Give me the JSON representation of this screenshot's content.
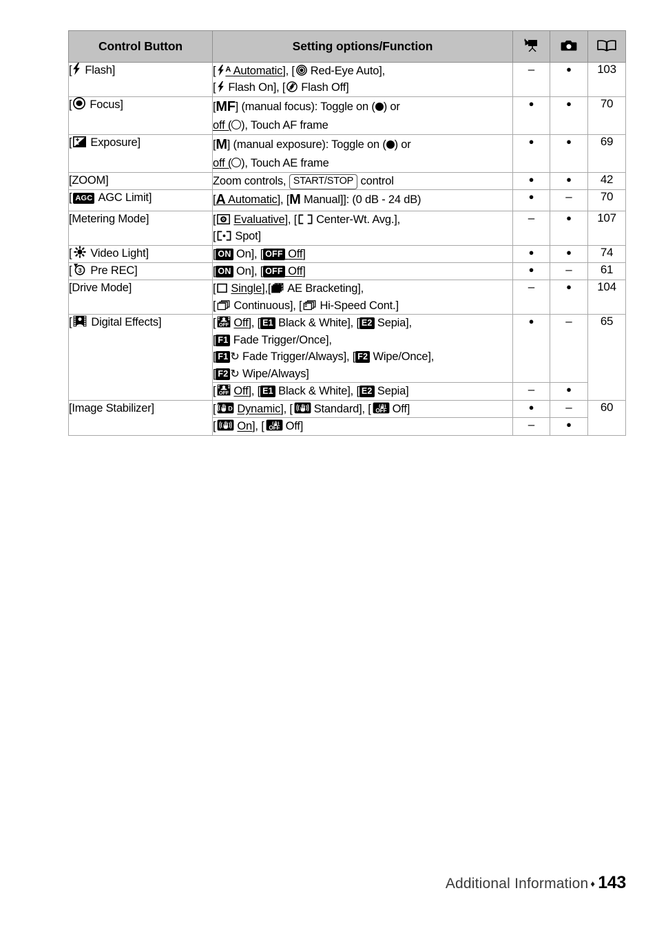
{
  "document": {
    "footer_label": "Additional Information",
    "footer_separator": "♦",
    "page_number": "143"
  },
  "table": {
    "headers": {
      "control_button": "Control Button",
      "setting_options": "Setting options/Function",
      "movie_mode_icon": "video-camera-icon",
      "photo_mode_icon": "photo-camera-icon",
      "page_ref_icon": "open-book-icon"
    },
    "marks": {
      "available": "●",
      "unavailable": "–"
    },
    "rows": [
      {
        "button_label": "Flash]",
        "button_bracket": "[",
        "button_icon": "flash-icon",
        "options_lines": [
          "[ A Automatic], [ Red-Eye Auto],",
          "[ Flash On], [ Flash Off]"
        ],
        "options_text": "[⚡A Automatic], [◉ Red-Eye Auto], [⚡ Flash On], [⚡⃠ Flash Off]",
        "default_option": "Automatic",
        "movie": "–",
        "photo": "●",
        "page": "103"
      },
      {
        "button_label": "Focus]",
        "button_bracket": "[",
        "button_icon": "focus-icon",
        "options_text": "[MF] (manual focus): Toggle on (●) or off (○), Touch AF frame",
        "default_option": "off",
        "movie": "●",
        "photo": "●",
        "page": "70"
      },
      {
        "button_label": "Exposure]",
        "button_bracket": "[",
        "button_icon": "exposure-icon",
        "options_text": "[M] (manual exposure): Toggle on (●) or off (○), Touch AE frame",
        "default_option": "off",
        "movie": "●",
        "photo": "●",
        "page": "69"
      },
      {
        "button_label": "[ZOOM]",
        "button_icon": "",
        "options_text": "Zoom controls, START/STOP control",
        "keycap": "START/STOP",
        "movie": "●",
        "photo": "●",
        "page": "42"
      },
      {
        "button_label": "AGC Limit]",
        "button_bracket": "[",
        "button_icon": "agc-badge-icon",
        "button_badge": "AGC",
        "options_text": "[A Automatic], [M Manual]]: (0 dB - 24 dB)",
        "default_option": "Automatic",
        "movie": "●",
        "photo": "–",
        "page": "70"
      },
      {
        "button_label": "[Metering Mode]",
        "button_icon": "",
        "options_text": "[Evaluative], [Center-Wt. Avg.], [Spot]",
        "default_option": "Evaluative",
        "movie": "–",
        "photo": "●",
        "page": "107"
      },
      {
        "button_label": "Video Light]",
        "button_bracket": "[",
        "button_icon": "video-light-icon",
        "options_text": "[ON On], [OFF Off]",
        "default_option": "Off",
        "movie": "●",
        "photo": "●",
        "page": "74"
      },
      {
        "button_label": "Pre REC]",
        "button_bracket": "[",
        "button_icon": "pre-rec-icon",
        "options_text": "[ON On], [OFF Off]",
        "default_option": "Off",
        "movie": "●",
        "photo": "–",
        "page": "61"
      },
      {
        "button_label": "[Drive Mode]",
        "button_icon": "",
        "options_text": "[Single], [AE Bracketing], [Continuous], [Hi-Speed Cont.]",
        "default_option": "Single",
        "movie": "–",
        "photo": "●",
        "page": "104"
      },
      {
        "button_label": "Digital Effects]",
        "button_bracket": "[",
        "button_icon": "digital-effects-icon",
        "options_text": "[OFF Off], [E1 Black & White], [E2 Sepia], [F1 Fade Trigger/Once], [F1↻ Fade Trigger/Always], [F2 Wipe/Once], [F2↻ Wipe/Always]",
        "options_text_2": "[OFF Off], [E1 Black & White], [E2 Sepia]",
        "default_option": "Off",
        "movie": "●",
        "photo": "–",
        "movie_2": "–",
        "photo_2": "●",
        "page": "65"
      },
      {
        "button_label": "[Image Stabilizer]",
        "button_icon": "",
        "options_text": "[Dynamic], [Standard], [Off]",
        "options_text_2": "[On], [Off]",
        "default_option": "Dynamic",
        "default_option_2": "On",
        "movie": "●",
        "photo": "–",
        "movie_2": "–",
        "photo_2": "●",
        "page": "60"
      }
    ],
    "labels": {
      "flash_automatic": "Automatic",
      "flash_redeye": "Red-Eye Auto",
      "flash_on": "Flash On",
      "flash_off": "Flash Off",
      "focus_mf": "MF",
      "focus_manual": "(manual focus): Toggle on (",
      "focus_or": ") or",
      "focus_off": "off",
      "focus_touch": "), Touch AF frame",
      "exposure_m": "M",
      "exposure_manual": "(manual exposure): Toggle on (",
      "exposure_touch": "), Touch AE frame",
      "zoom_controls": "Zoom controls,",
      "zoom_keycap": "START/STOP",
      "zoom_control_word": "control",
      "agc_a": "A",
      "agc_automatic": "Automatic",
      "agc_m": "M",
      "agc_manual": "Manual]]: (0 dB - 24 dB)",
      "metering_evaluative": "Evaluative",
      "metering_center": "Center-Wt. Avg.",
      "metering_spot": "Spot",
      "on": "On",
      "off": "Off",
      "badge_on": "ON",
      "badge_off": "OFF",
      "drive_single": "Single",
      "drive_ae_bracketing": "AE Bracketing",
      "drive_continuous": "Continuous",
      "drive_hispeed": "Hi-Speed Cont.",
      "de_black_white": "Black & White",
      "de_sepia": "Sepia",
      "de_fade_once": "Fade Trigger/Once",
      "de_fade_always": "Fade Trigger/Always",
      "de_wipe_once": "Wipe/Once",
      "de_wipe_always": "Wipe/Always",
      "badge_e1": "E1",
      "badge_e2": "E2",
      "badge_f1": "F1",
      "badge_f2": "F2",
      "is_dynamic": "Dynamic",
      "is_standard": "Standard",
      "btn_flash": "Flash]",
      "btn_focus": "Focus]",
      "btn_exposure": "Exposure]",
      "btn_zoom": "[ZOOM]",
      "btn_agc": "AGC Limit]",
      "btn_metering": "[Metering Mode]",
      "btn_video_light": "Video Light]",
      "btn_pre_rec": "Pre REC]",
      "btn_drive": "[Drive Mode]",
      "btn_digital_effects": "Digital Effects]",
      "btn_image_stabilizer": "[Image Stabilizer]",
      "open_bracket": "[",
      "close_bracket": "]",
      "comma": ",",
      "badge_agc": "AGC"
    }
  }
}
